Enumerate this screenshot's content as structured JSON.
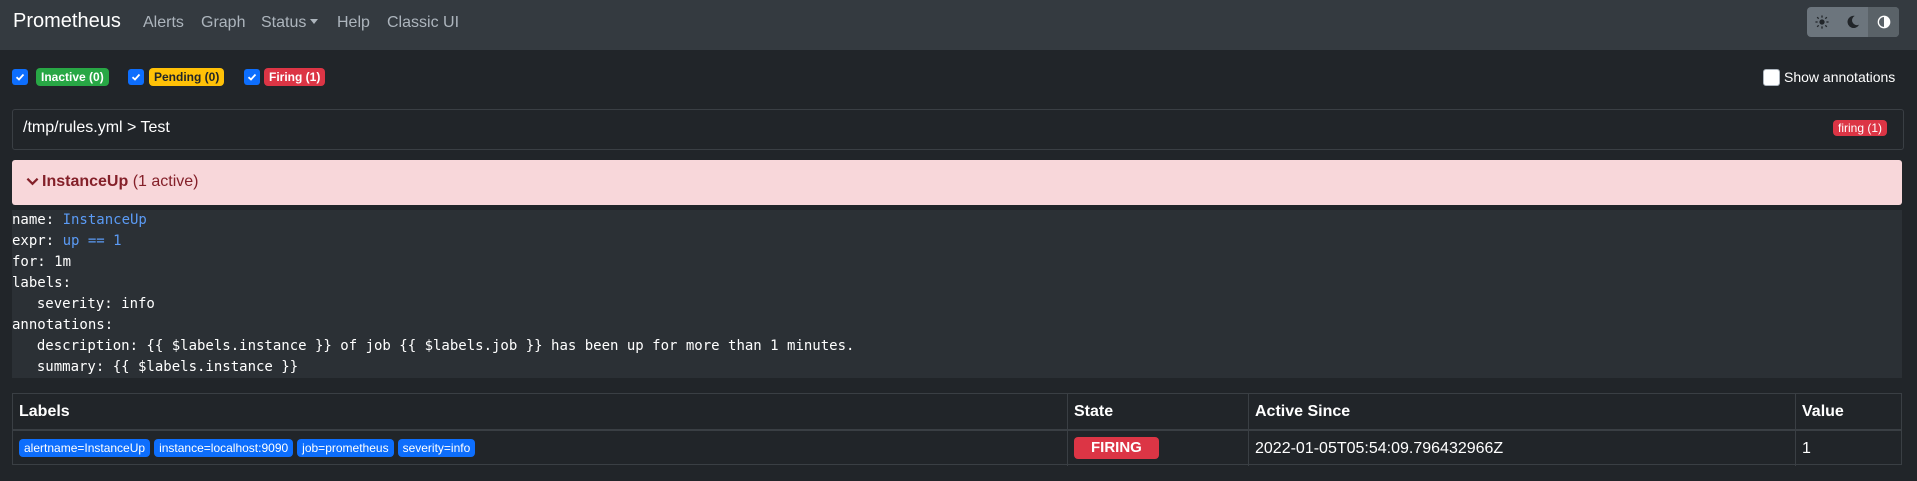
{
  "navbar": {
    "brand": "Prometheus",
    "links": [
      "Alerts",
      "Graph",
      "Status",
      "Help",
      "Classic UI"
    ],
    "theme_icons": [
      "sun-icon",
      "moon-icon",
      "contrast-icon"
    ]
  },
  "filters": {
    "inactive": {
      "label": "Inactive (0)",
      "checked": true,
      "color": "#28a745"
    },
    "pending": {
      "label": "Pending (0)",
      "checked": true,
      "color": "#ffc107"
    },
    "firing": {
      "label": "Firing (1)",
      "checked": true,
      "color": "#dc3545"
    },
    "show_annotations": {
      "label": "Show annotations",
      "checked": false
    }
  },
  "group": {
    "title": "/tmp/rules.yml > Test",
    "badge": "firing (1)"
  },
  "rule": {
    "name": "InstanceUp",
    "active": "(1 active)",
    "yaml": {
      "name_key": "name: ",
      "name_val": "InstanceUp",
      "expr_key": "expr: ",
      "expr_val": "up == 1",
      "for": "for: 1m",
      "labels": "labels:",
      "severity": "  severity: info",
      "annotations": "annotations:",
      "description": "  description: {{ $labels.instance }} of job {{ $labels.job }} has been up for more than 1 minutes.",
      "summary": "  summary: {{ $labels.instance }}"
    }
  },
  "table": {
    "headers": {
      "labels": "Labels",
      "state": "State",
      "active_since": "Active Since",
      "value": "Value"
    },
    "rows": [
      {
        "labels": [
          "alertname=InstanceUp",
          "instance=localhost:9090",
          "job=prometheus",
          "severity=info"
        ],
        "state": "FIRING",
        "active_since": "2022-01-05T05:54:09.796432966Z",
        "value": "1"
      }
    ]
  },
  "colors": {
    "accent": "#0d6efd",
    "firing": "#dc3545",
    "rule_header_bg": "#f8d7da"
  }
}
